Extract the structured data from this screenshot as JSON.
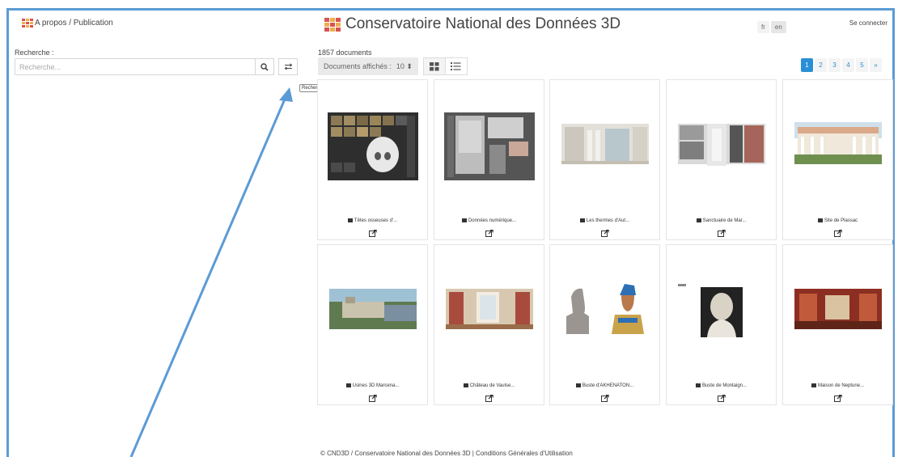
{
  "header": {
    "nav_link": "A propos / Publication",
    "site_title": "Conservatoire National des Données 3D",
    "languages": [
      "fr",
      "en"
    ],
    "login_label": "Se connecter"
  },
  "search": {
    "label": "Recherche :",
    "placeholder": "Recherche...",
    "advanced_tooltip": "Recherche avancée"
  },
  "results": {
    "count_text": "1857 documents",
    "per_page_label": "Documents affichés :",
    "per_page_value": "10 ⬍"
  },
  "pagination": {
    "pages": [
      "1",
      "2",
      "3",
      "4",
      "5",
      "»"
    ],
    "current": "1"
  },
  "documents": [
    {
      "title": "Têtes osseuses d'..."
    },
    {
      "title": "Données numérique..."
    },
    {
      "title": "Les thermes d'Aut..."
    },
    {
      "title": "Sanctuaire de Mar..."
    },
    {
      "title": "Site de Plassac"
    },
    {
      "title": "Usines 3D Marcena..."
    },
    {
      "title": "Château de Vaulse..."
    },
    {
      "title": "Buste d'AKHENATON..."
    },
    {
      "title": "Buste de Montaign..."
    },
    {
      "title": "Maison de Neptune..."
    }
  ],
  "footer": {
    "text": "© CND3D / Conservatoire National des Données 3D | Conditions Générales d'Utilisation"
  },
  "colors": {
    "accent": "#2a8fd6",
    "frame": "#5b9bd5",
    "logo_red": "#d9534f",
    "logo_orange": "#f0ad4e"
  }
}
